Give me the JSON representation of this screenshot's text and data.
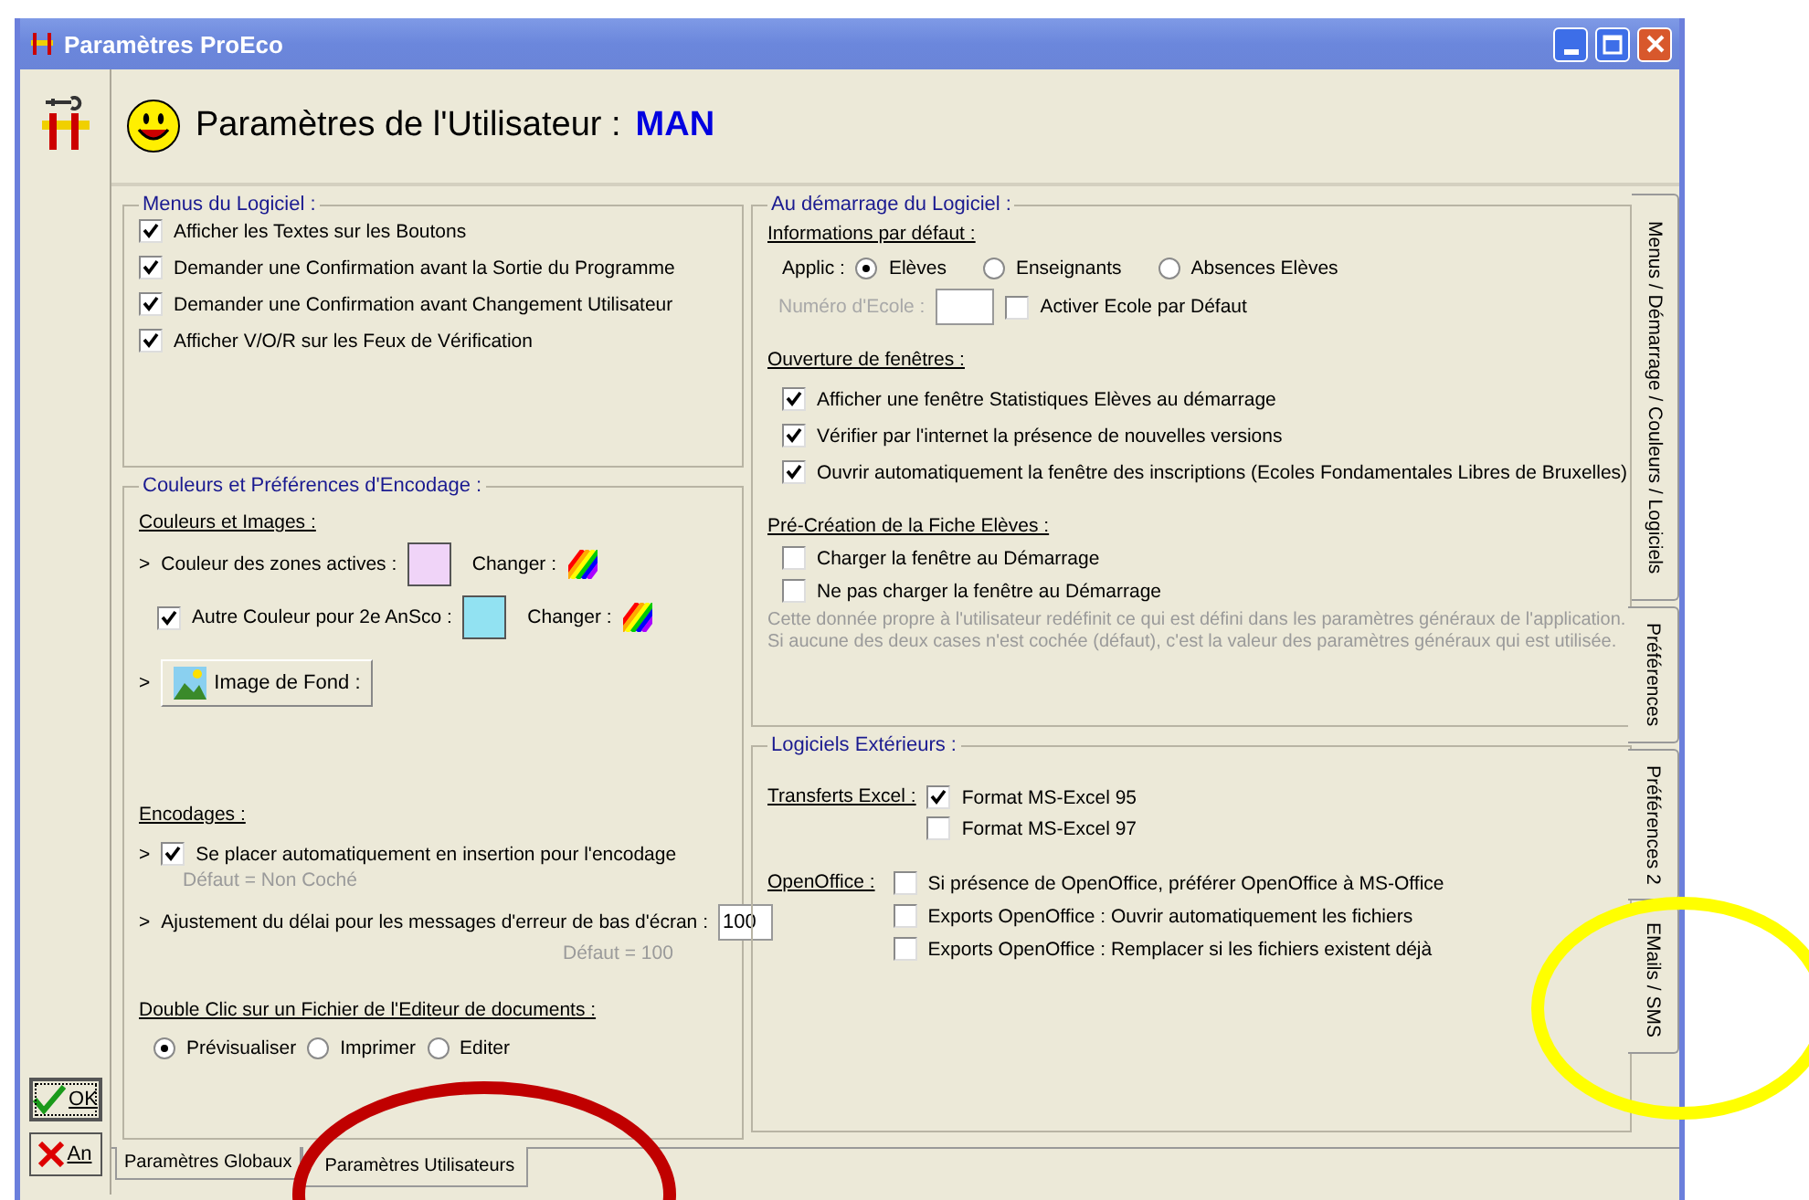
{
  "window": {
    "title": "Paramètres ProEco"
  },
  "header": {
    "title": "Paramètres de l'Utilisateur :",
    "user": "MAN"
  },
  "left_buttons": [
    {
      "kind": "ok",
      "label": "OK"
    },
    {
      "kind": "cancel",
      "label": "An"
    }
  ],
  "menus_group": {
    "title": "Menus du Logiciel :",
    "options": [
      {
        "label": "Afficher les Textes sur les Boutons",
        "checked": true
      },
      {
        "label": "Demander une Confirmation avant la Sortie du Programme",
        "checked": true
      },
      {
        "label": "Demander une Confirmation avant Changement Utilisateur",
        "checked": true
      },
      {
        "label": "Afficher V/O/R sur les Feux de Vérification",
        "checked": true
      }
    ]
  },
  "colors_group": {
    "title": "Couleurs et Préférences d'Encodage :",
    "images_heading": "Couleurs et Images :",
    "active_color": {
      "bullet": ">",
      "label": "Couleur des zones actives :",
      "color": "#f0d4f8",
      "change_label": "Changer :"
    },
    "alt_color": {
      "label": "Autre Couleur pour 2e AnSco :",
      "checked": true,
      "color": "#92e2f2",
      "change_label": "Changer :"
    },
    "background": {
      "bullet": ">",
      "button": "Image de Fond :"
    },
    "encoding_heading": "Encodages :",
    "insert_option": {
      "bullet": ">",
      "label": "Se placer automatiquement en insertion pour l'encodage",
      "checked": true,
      "default_note": "Défaut = Non Coché"
    },
    "delay": {
      "bullet": ">",
      "label": "Ajustement du délai pour les messages d'erreur de bas d'écran :",
      "value": "100",
      "default_note": "Défaut = 100"
    },
    "doubleclick_heading": "Double Clic sur un Fichier de l'Editeur de documents :",
    "doubleclick_options": [
      {
        "label": "Prévisualiser",
        "selected": true
      },
      {
        "label": "Imprimer",
        "selected": false
      },
      {
        "label": "Editer",
        "selected": false
      }
    ]
  },
  "startup_group": {
    "title": "Au démarrage du Logiciel :",
    "defaults_heading": "Informations par défaut :",
    "applic_label": "Applic :",
    "applic_options": [
      {
        "label": "Elèves",
        "selected": true
      },
      {
        "label": "Enseignants",
        "selected": false
      },
      {
        "label": "Absences Elèves",
        "selected": false
      }
    ],
    "school_number": {
      "label": "Numéro d'Ecole :",
      "disabled": true
    },
    "school_default": {
      "label": "Activer Ecole par Défaut",
      "checked": false
    },
    "windows_heading": "Ouverture de fenêtres :",
    "windows_options": [
      {
        "label": "Afficher une fenêtre Statistiques Elèves au démarrage",
        "checked": true
      },
      {
        "label": "Vérifier par l'internet la présence de nouvelles versions",
        "checked": true
      },
      {
        "label": "Ouvrir automatiquement la fenêtre des inscriptions (Ecoles Fondamentales Libres de Bruxelles)",
        "checked": true
      }
    ],
    "precreation_heading": "Pré-Création de la Fiche Elèves :",
    "precreation_options": [
      {
        "label": "Charger la fenêtre au Démarrage",
        "checked": false
      },
      {
        "label": "Ne pas charger la fenêtre au Démarrage",
        "checked": false
      }
    ],
    "note_lines": [
      "Cette donnée propre à l'utilisateur redéfinit ce qui est défini dans les paramètres généraux de l'application.",
      "Si aucune des deux cases n'est cochée (défaut), c'est la valeur des paramètres généraux qui est utilisée."
    ]
  },
  "external_group": {
    "title": "Logiciels Extérieurs :",
    "excel_heading": "Transferts Excel :",
    "excel_options": [
      {
        "label": "Format MS-Excel 95",
        "checked": true
      },
      {
        "label": "Format MS-Excel 97",
        "checked": false
      }
    ],
    "openoffice_heading": "OpenOffice :",
    "openoffice_options": [
      {
        "label": "Si présence de OpenOffice, préférer OpenOffice à MS-Office",
        "checked": false
      },
      {
        "label": "Exports OpenOffice : Ouvrir automatiquement les fichiers",
        "checked": false
      },
      {
        "label": "Exports OpenOffice  : Remplacer si les fichiers existent déjà",
        "checked": false
      }
    ]
  },
  "side_tabs": [
    {
      "label": "Menus / Démarrage / Couleurs / Logiciels",
      "selected": true
    },
    {
      "label": "Préférences",
      "selected": false
    },
    {
      "label": "Préférences 2",
      "selected": false
    },
    {
      "label": "EMails / SMS",
      "selected": false
    }
  ],
  "bottom_tabs": [
    {
      "label": "Paramètres Globaux",
      "selected": false
    },
    {
      "label": "Paramètres Utilisateurs",
      "selected": true
    }
  ],
  "annotations": [
    {
      "kind": "ellipse",
      "color": "#c00000"
    },
    {
      "kind": "ellipse",
      "color": "#ffff00"
    }
  ]
}
